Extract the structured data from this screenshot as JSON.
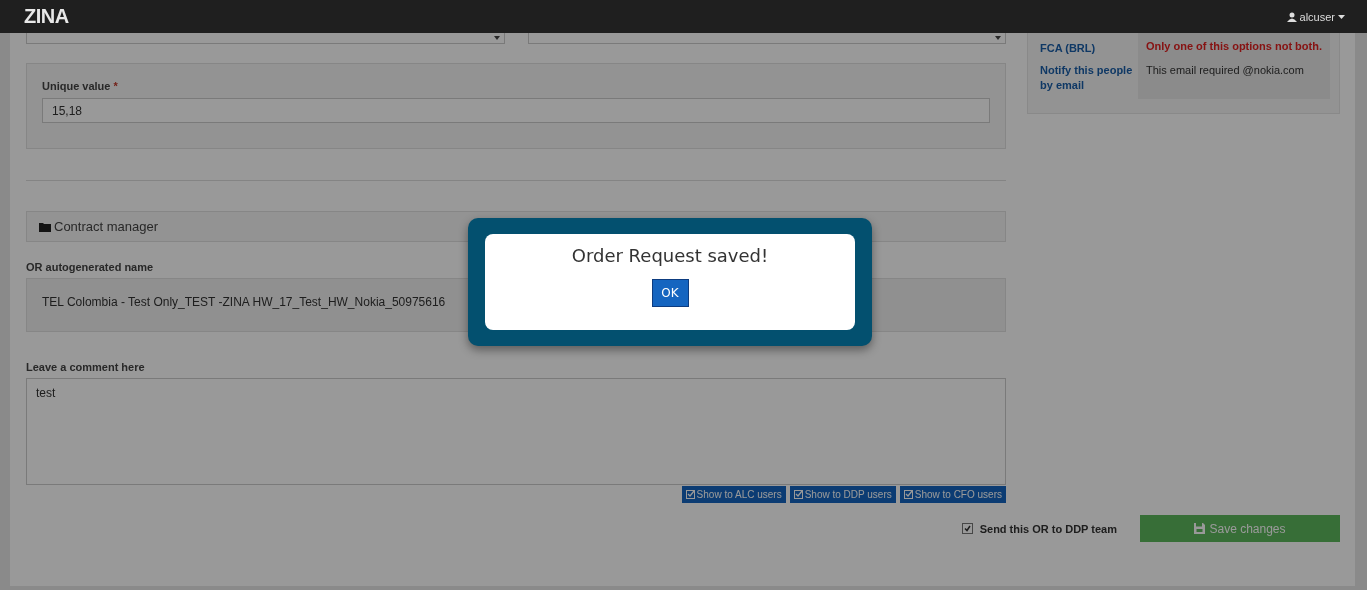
{
  "header": {
    "logo": "ZINA",
    "user": "alcuser"
  },
  "unique_value": {
    "label": "Unique value",
    "required_mark": "*",
    "value": "15,18"
  },
  "contract_manager": {
    "title": "Contract manager"
  },
  "autogenerated_name": {
    "label": "OR autogenerated name",
    "value": "TEL Colombia - Test Only_TEST -ZINA HW_17_Test_HW_Nokia_50975616"
  },
  "comment": {
    "label": "Leave a comment here",
    "value": "test"
  },
  "show_buttons": [
    {
      "label": "Show to ALC users"
    },
    {
      "label": "Show to DDP users"
    },
    {
      "label": "Show to CFO users"
    }
  ],
  "send_to_ddp": {
    "label": "Send this OR to DDP team",
    "checked": true
  },
  "save_button": {
    "label": "Save changes"
  },
  "info_table": {
    "rows": [
      {
        "label": "FCA (BRL)",
        "value": "Only one of this options not both.",
        "kind": "warning"
      },
      {
        "label": "Notify this people by email",
        "value": "This email required @nokia.com",
        "kind": "note"
      }
    ]
  },
  "dialog": {
    "message": "Order Request saved!",
    "button": "OK"
  }
}
